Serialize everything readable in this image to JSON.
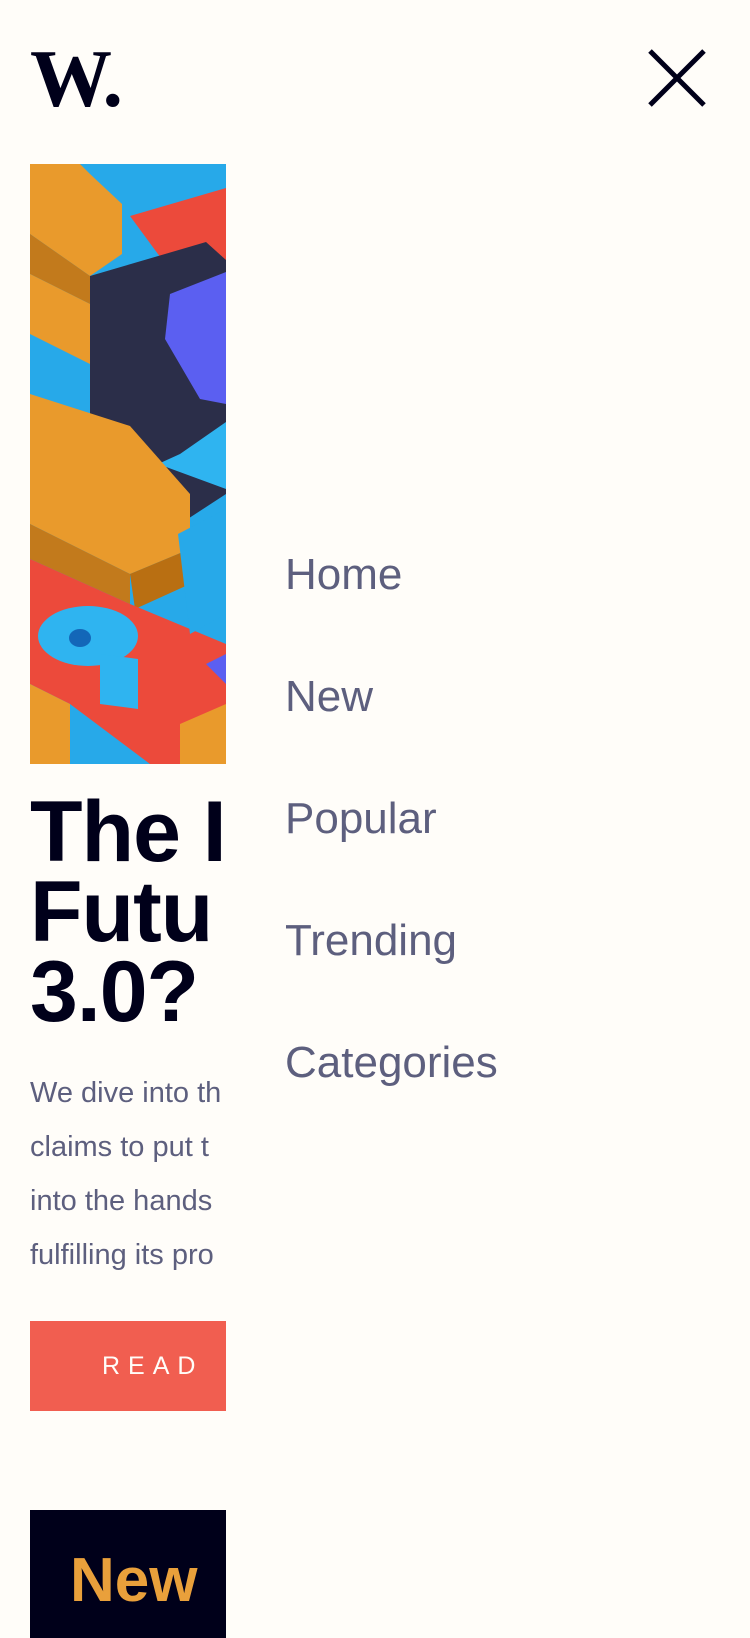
{
  "header": {
    "logo_text": "W."
  },
  "icons": {
    "close": "close-icon"
  },
  "article": {
    "headline": "The I\nFutu\n3.0?",
    "excerpt": "We dive into th\nclaims to put t\ninto the hands\nfulfilling its pro",
    "read_button": "READ"
  },
  "next_section": {
    "title": "New"
  },
  "nav": {
    "items": [
      {
        "label": "Home"
      },
      {
        "label": "New"
      },
      {
        "label": "Popular"
      },
      {
        "label": "Trending"
      },
      {
        "label": "Categories"
      }
    ]
  },
  "colors": {
    "background": "#fffdf9",
    "ink": "#00001a",
    "muted": "#5d5f7e",
    "accent_red": "#f15e50",
    "accent_gold": "#e9a03b"
  }
}
